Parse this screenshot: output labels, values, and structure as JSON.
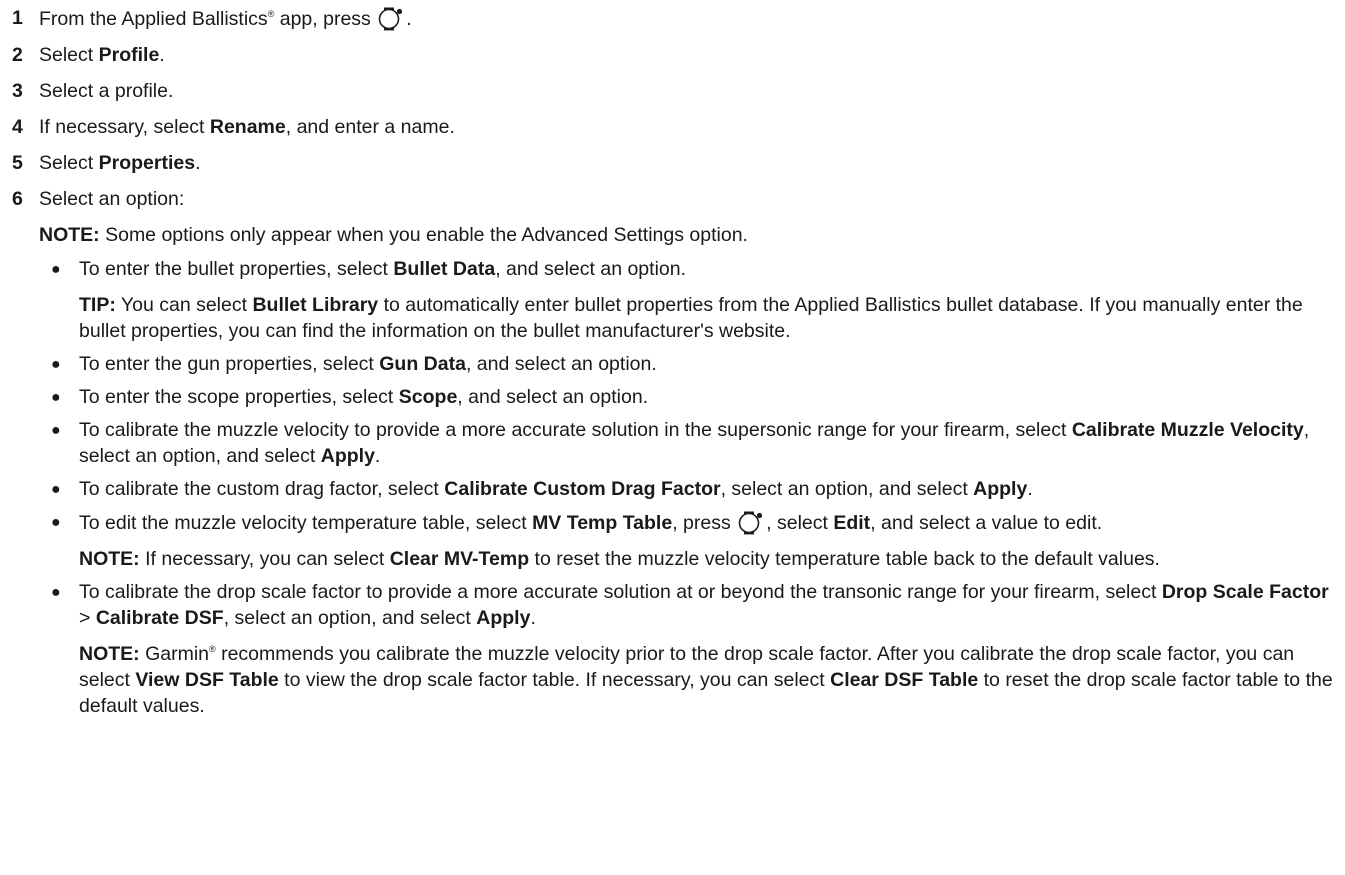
{
  "steps": [
    {
      "num": "1",
      "parts": [
        "From the Applied Ballistics",
        "®",
        " app, press ",
        "[icon]",
        "."
      ]
    },
    {
      "num": "2",
      "pre": "Select ",
      "bold": "Profile",
      "post": "."
    },
    {
      "num": "3",
      "text": "Select a profile."
    },
    {
      "num": "4",
      "pre": "If necessary, select ",
      "bold": "Rename",
      "post": ", and enter a name."
    },
    {
      "num": "5",
      "pre": "Select ",
      "bold": "Properties",
      "post": "."
    },
    {
      "num": "6",
      "text": "Select an option:"
    }
  ],
  "step1": {
    "num": "1",
    "t1": "From the Applied Ballistics",
    "reg": "®",
    "t2": " app, press ",
    "t3": "."
  },
  "step6_note": {
    "label": "NOTE:",
    "text": " Some options only appear when you enable the Advanced Settings option."
  },
  "bullets": {
    "b1": {
      "pre": "To enter the bullet properties, select ",
      "bold": "Bullet Data",
      "post": ", and select an option.",
      "tip_label": "TIP:",
      "tip_pre": " You can select ",
      "tip_bold": "Bullet Library",
      "tip_post": " to automatically enter bullet properties from the Applied Ballistics bullet database. If you manually enter the bullet properties, you can find the information on the bullet manufacturer's website."
    },
    "b2": {
      "pre": "To enter the gun properties, select ",
      "bold": "Gun Data",
      "post": ", and select an option."
    },
    "b3": {
      "pre": "To enter the scope properties, select ",
      "bold": "Scope",
      "post": ", and select an option."
    },
    "b4": {
      "pre": "To calibrate the muzzle velocity to provide a more accurate solution in the supersonic range for your firearm, select ",
      "bold": "Calibrate Muzzle Velocity",
      "mid": ", select an option, and select ",
      "bold2": "Apply",
      "post": "."
    },
    "b5": {
      "pre": "To calibrate the custom drag factor, select ",
      "bold": "Calibrate Custom Drag Factor",
      "mid": ", select an option, and select ",
      "bold2": "Apply",
      "post": "."
    },
    "b6": {
      "pre": "To edit the muzzle velocity temperature table, select ",
      "bold": "MV Temp Table",
      "mid": ", press ",
      "mid2": ", select ",
      "bold2": "Edit",
      "post": ", and select a value to edit.",
      "note_label": "NOTE:",
      "note_pre": " If necessary, you can select ",
      "note_bold": "Clear MV-Temp",
      "note_post": " to reset the muzzle velocity temperature table back to the default values."
    },
    "b7": {
      "pre": "To calibrate the drop scale factor to provide a more accurate solution at or beyond the transonic range for your firearm, select ",
      "bold": "Drop Scale Factor",
      "sep": " > ",
      "bold2": "Calibrate DSF",
      "mid": ", select an option, and select ",
      "bold3": "Apply",
      "post": ".",
      "note_label": "NOTE:",
      "note_t1": " Garmin",
      "note_reg": "®",
      "note_t2": " recommends you calibrate the muzzle velocity prior to the drop scale factor. After you calibrate the drop scale factor, you can select ",
      "note_bold1": "View DSF Table",
      "note_t3": " to view the drop scale factor table. If necessary, you can select ",
      "note_bold2": "Clear DSF Table",
      "note_t4": " to reset the drop scale factor table to the default values."
    }
  },
  "icons": {
    "watch_button": "watch-button-icon",
    "bullet": "●"
  }
}
